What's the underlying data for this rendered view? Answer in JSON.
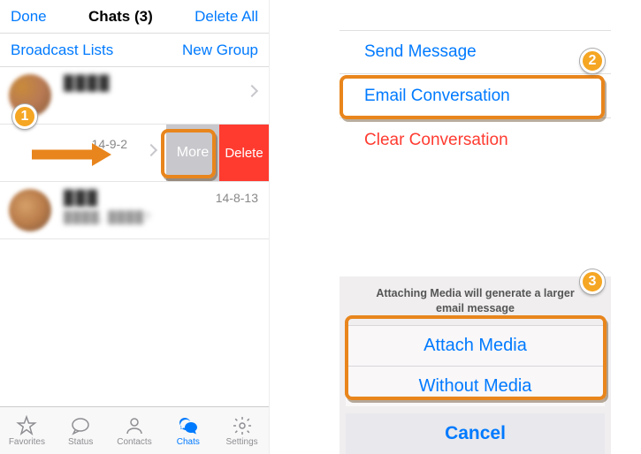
{
  "header": {
    "done": "Done",
    "title": "Chats (3)",
    "deleteAll": "Delete All"
  },
  "subheader": {
    "broadcast": "Broadcast Lists",
    "newGroup": "New Group"
  },
  "rows": {
    "r2date": "14-9-2",
    "more": "More",
    "delete": "Delete",
    "r3date": "14-8-13",
    "r1name": "████",
    "r3name": "███",
    "r3sub": "████, ████?"
  },
  "tabs": {
    "favorites": "Favorites",
    "status": "Status",
    "contacts": "Contacts",
    "chats": "Chats",
    "settings": "Settings"
  },
  "menu": {
    "send": "Send Message",
    "email": "Email Conversation",
    "clear": "Clear Conversation"
  },
  "sheet": {
    "sub": "Attaching Media will generate a larger email message",
    "attach": "Attach Media",
    "without": "Without Media",
    "cancel": "Cancel"
  },
  "annotations": {
    "b1": "1",
    "b2": "2",
    "b3": "3"
  }
}
